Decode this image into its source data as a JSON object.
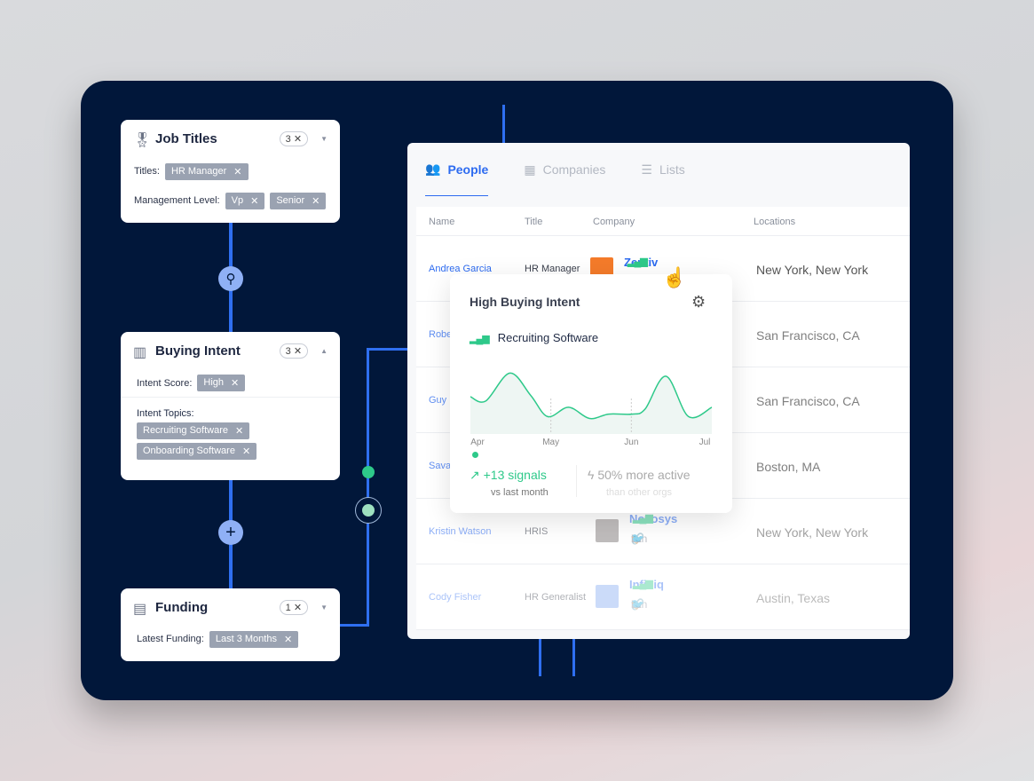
{
  "filters": {
    "job_titles": {
      "title": "Job Titles",
      "count": "3",
      "titles_label": "Titles:",
      "titles": [
        "HR Manager"
      ],
      "level_label": "Management Level:",
      "levels": [
        "Vp",
        "Senior"
      ]
    },
    "buying_intent": {
      "title": "Buying Intent",
      "count": "3",
      "score_label": "Intent Score:",
      "score": "High",
      "topics_label": "Intent Topics:",
      "topics": [
        "Recruiting Software",
        "Onboarding Software"
      ]
    },
    "funding": {
      "title": "Funding",
      "count": "1",
      "latest_label": "Latest Funding:",
      "latest": "Last 3 Months"
    }
  },
  "tabs": [
    {
      "label": "People",
      "active": true
    },
    {
      "label": "Companies"
    },
    {
      "label": "Lists"
    }
  ],
  "columns": [
    "Name",
    "Title",
    "Company",
    "Locations"
  ],
  "rows": [
    {
      "name": "Andrea Garcia",
      "title": "HR Manager",
      "company": "Zentiv",
      "location": "New York, New York",
      "logo_color": "#f47b2a"
    },
    {
      "name": "Robe",
      "title": "",
      "company": "",
      "location": "San Francisco, CA"
    },
    {
      "name": "Guy",
      "title": "",
      "company": "",
      "location": "San Francisco, CA"
    },
    {
      "name": "Sava",
      "title": "",
      "company": "",
      "location": "Boston, MA"
    },
    {
      "name": "Kristin Watson",
      "title": "HRIS",
      "company": "Novosys",
      "location": "New York, New York",
      "logo_color": "#8a8585"
    },
    {
      "name": "Cody Fisher",
      "title": "HR Generalist",
      "company": "Infiniq",
      "location": "Austin, Texas",
      "logo_color": "#7ea6f0"
    }
  ],
  "popup": {
    "title": "High Buying Intent",
    "topic": "Recruiting Software",
    "signals": "+13 signals",
    "signals_sub": "vs last month",
    "active": "50% more active",
    "active_sub": "than other orgs"
  },
  "chart_data": {
    "type": "area",
    "x_ticks": [
      "Apr",
      "May",
      "Jun",
      "Jul"
    ],
    "x": [
      0,
      0.19,
      0.49,
      0.75,
      0.96,
      1.22,
      1.48,
      1.72,
      2.01,
      2.17,
      2.43,
      2.71,
      3
    ],
    "values": [
      60,
      53,
      98,
      62,
      28,
      43,
      25,
      32,
      32,
      40,
      93,
      28,
      43
    ],
    "color": "#2ec98a"
  },
  "colors": {
    "accent": "#2d6bf0",
    "panel": "#01173a",
    "green": "#2ec98a"
  }
}
